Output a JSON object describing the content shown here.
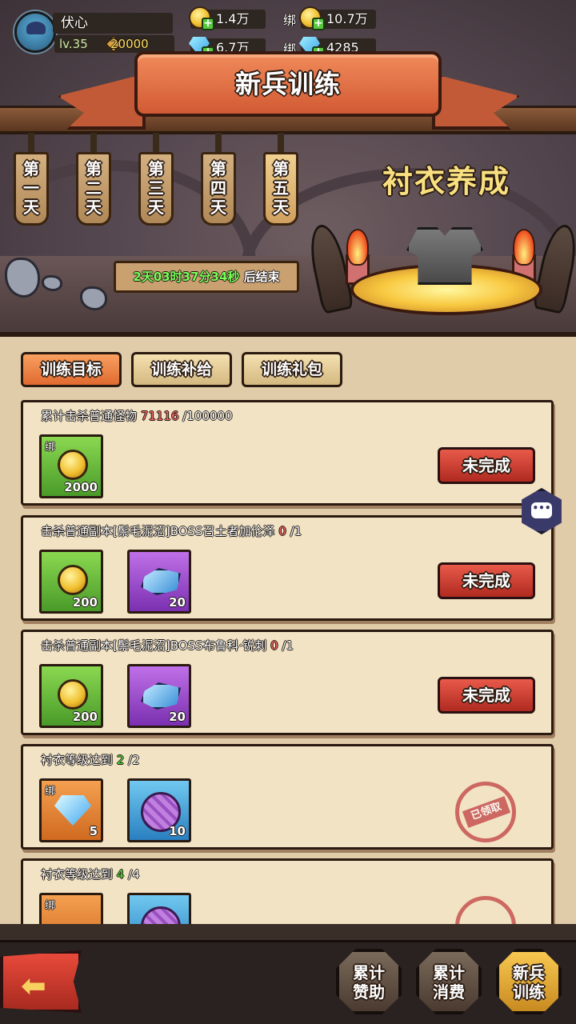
{
  "player": {
    "name": "伏心",
    "level": "lv.35",
    "power": "20000"
  },
  "currency": {
    "gold": "1.4万",
    "bind_label_1": "绑",
    "bound_gold": "10.7万",
    "diamond": "6.7万",
    "bind_label_2": "绑",
    "bound_diamond": "4285"
  },
  "title": "新兵训练",
  "days": [
    {
      "a": "第",
      "b": "一",
      "c": "天"
    },
    {
      "a": "第",
      "b": "二",
      "c": "天"
    },
    {
      "a": "第",
      "b": "三",
      "c": "天"
    },
    {
      "a": "第",
      "b": "四",
      "c": "天"
    },
    {
      "a": "第",
      "b": "五",
      "c": "天"
    }
  ],
  "costume_title": "衬衣养成",
  "timer": {
    "value": "2天03时37分34秒",
    "suffix": "后结束"
  },
  "tabs": [
    {
      "label": "训练目标"
    },
    {
      "label": "训练补给"
    },
    {
      "label": "训练礼包"
    }
  ],
  "tasks": [
    {
      "title": "累计击杀普通怪物",
      "progress": "71116",
      "target": "/100000",
      "rewards": [
        {
          "bind": "绑",
          "qty": "2000"
        }
      ],
      "status": "未完成"
    },
    {
      "title": "击杀普通副本[鬃毛泥沼]BOSS召土者加伦泽",
      "progress": "0",
      "target": "/1",
      "rewards": [
        {
          "qty": "200"
        },
        {
          "qty": "20"
        }
      ],
      "status": "未完成"
    },
    {
      "title": "击杀普通副本[鬃毛泥沼]BOSS布鲁科·锐刺",
      "progress": "0",
      "target": "/1",
      "rewards": [
        {
          "qty": "200"
        },
        {
          "qty": "20"
        }
      ],
      "status": "未完成"
    },
    {
      "title": "衬衣等级达到",
      "progress": "2",
      "target": "/2",
      "rewards": [
        {
          "bind": "绑",
          "qty": "5"
        },
        {
          "qty": "10"
        }
      ],
      "status": "已领取"
    },
    {
      "title": "衬衣等级达到",
      "progress": "4",
      "target": "/4",
      "rewards": [
        {
          "bind": "绑",
          "qty": ""
        },
        {
          "qty": ""
        }
      ],
      "status": "已领取"
    }
  ],
  "chat_icon": "chat-bubble-icon",
  "nav": [
    {
      "l1": "累计",
      "l2": "赞助"
    },
    {
      "l1": "累计",
      "l2": "消费"
    },
    {
      "l1": "新兵",
      "l2": "训练"
    }
  ],
  "back_arrow": "⬅"
}
